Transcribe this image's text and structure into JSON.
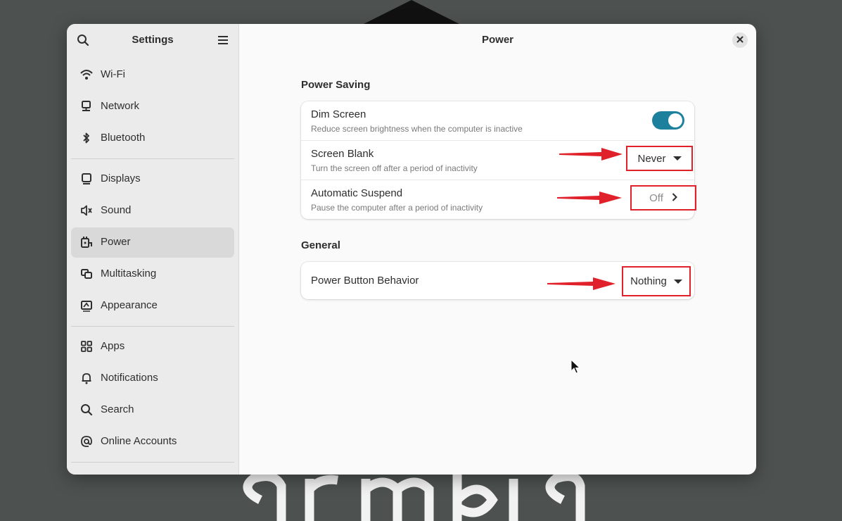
{
  "sidebar": {
    "title": "Settings",
    "search_icon": "search-icon",
    "menu_icon": "hamburger-menu-icon",
    "items": [
      {
        "label": "Wi-Fi",
        "icon": "wifi-icon"
      },
      {
        "label": "Network",
        "icon": "network-icon"
      },
      {
        "label": "Bluetooth",
        "icon": "bluetooth-icon"
      },
      {
        "label": "Displays",
        "icon": "display-icon"
      },
      {
        "label": "Sound",
        "icon": "speaker-icon"
      },
      {
        "label": "Power",
        "icon": "power-plug-icon",
        "active": true
      },
      {
        "label": "Multitasking",
        "icon": "multitasking-icon"
      },
      {
        "label": "Appearance",
        "icon": "appearance-icon"
      },
      {
        "label": "Apps",
        "icon": "apps-grid-icon"
      },
      {
        "label": "Notifications",
        "icon": "bell-icon"
      },
      {
        "label": "Search",
        "icon": "search-icon"
      },
      {
        "label": "Online Accounts",
        "icon": "at-sign-icon"
      }
    ]
  },
  "main": {
    "title": "Power",
    "power_saving": {
      "heading": "Power Saving",
      "dim_screen": {
        "title": "Dim Screen",
        "subtitle": "Reduce screen brightness when the computer is inactive",
        "enabled": true
      },
      "screen_blank": {
        "title": "Screen Blank",
        "subtitle": "Turn the screen off after a period of inactivity",
        "value": "Never"
      },
      "automatic_suspend": {
        "title": "Automatic Suspend",
        "subtitle": "Pause the computer after a period of inactivity",
        "value": "Off"
      }
    },
    "general": {
      "heading": "General",
      "power_button": {
        "title": "Power Button Behavior",
        "value": "Nothing"
      }
    }
  },
  "colors": {
    "accent": "#1d819e",
    "annotation": "#e0202a",
    "desktop_bg": "#4d5250"
  }
}
